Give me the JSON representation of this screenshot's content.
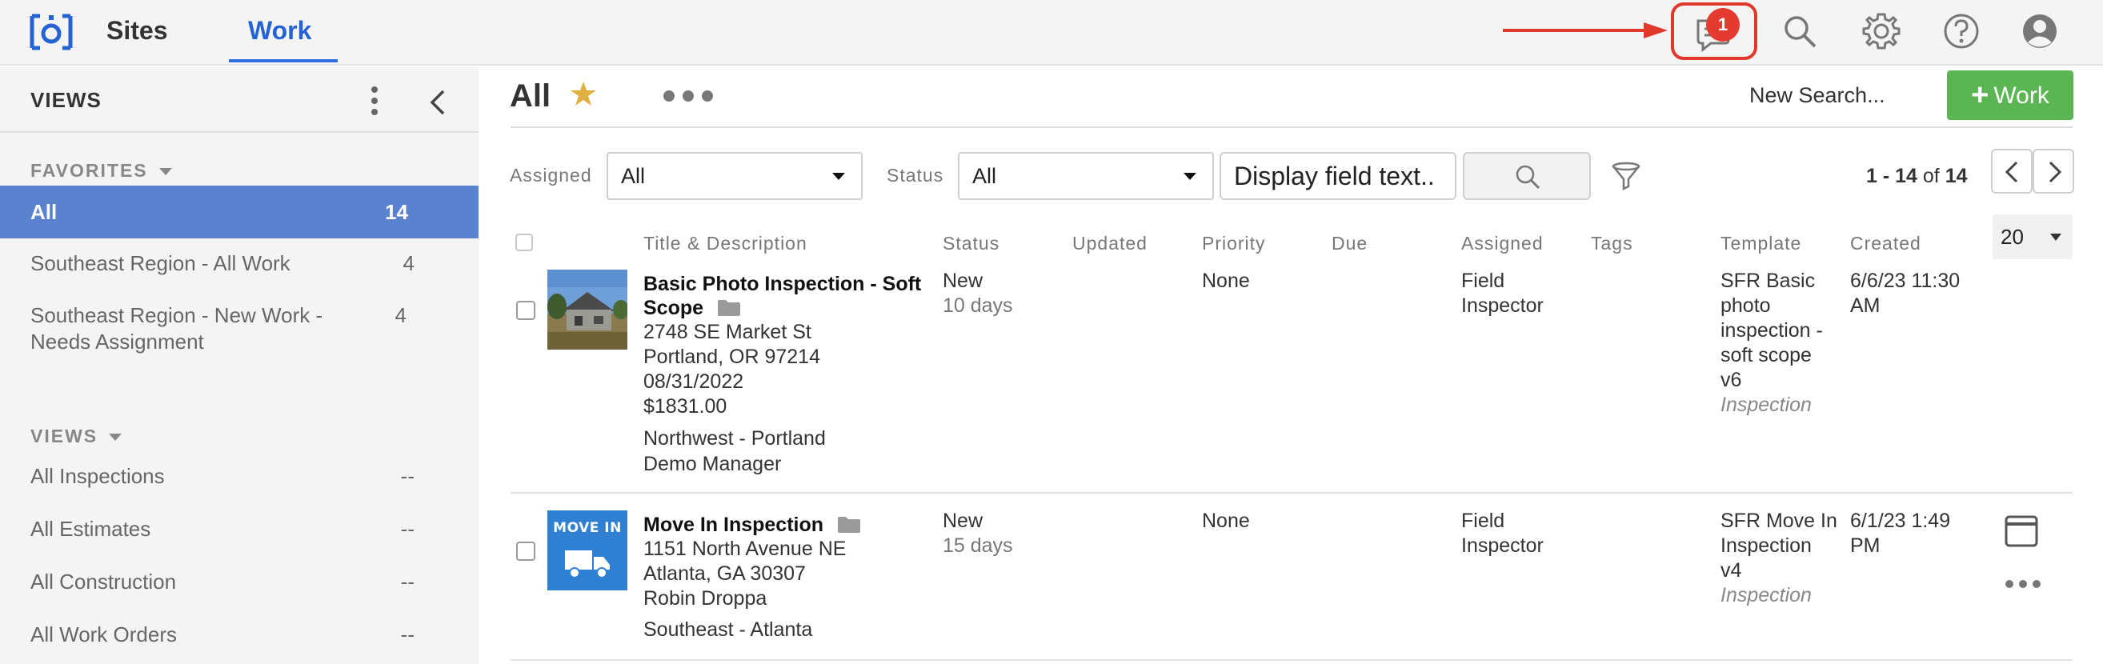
{
  "topbar": {
    "tabs": [
      {
        "label": "Sites"
      },
      {
        "label": "Work",
        "active": true
      }
    ],
    "notification_count": "1",
    "icons": [
      "chat-icon",
      "search-icon",
      "gear-icon",
      "help-icon",
      "user-icon"
    ]
  },
  "sidebar": {
    "title": "VIEWS",
    "favorites_label": "FAVORITES",
    "views_label": "VIEWS",
    "favorites": [
      {
        "label": "All",
        "count": "14"
      },
      {
        "label": "Southeast Region - All Work",
        "count": "4"
      },
      {
        "label": "Southeast Region - New Work -",
        "label2": "Needs Assignment",
        "count": "4"
      }
    ],
    "views": [
      {
        "label": "All Inspections",
        "count": "--"
      },
      {
        "label": "All Estimates",
        "count": "--"
      },
      {
        "label": "All Construction",
        "count": "--"
      },
      {
        "label": "All Work Orders",
        "count": "--"
      }
    ]
  },
  "main": {
    "title": "All",
    "new_search": "New Search...",
    "add_button": "Work",
    "filters": {
      "assigned_label": "Assigned",
      "assigned_value": "All",
      "status_label": "Status",
      "status_value": "All",
      "display_field": "Display field text.."
    },
    "paging": {
      "range": "1 - 14",
      "of": "of",
      "total": "14",
      "per_page": "20"
    },
    "columns": [
      "Title & Description",
      "Status",
      "Updated",
      "Priority",
      "Due",
      "Assigned",
      "Tags",
      "Template",
      "Created"
    ],
    "rows": [
      {
        "title_line1": "Basic Photo Inspection - Soft",
        "title_line2": "Scope",
        "address1": "2748 SE Market St",
        "address2": "Portland, OR 97214",
        "date": "08/31/2022",
        "amount": "$1831.00",
        "region": "Northwest - Portland",
        "manager": "Demo Manager",
        "status": "New",
        "status_age": "10 days",
        "priority": "None",
        "assigned1": "Field",
        "assigned2": "Inspector",
        "template": [
          "SFR Basic",
          "photo",
          "inspection -",
          "soft scope",
          "v6"
        ],
        "template_type": "Inspection",
        "created1": "6/6/23 11:30",
        "created2": "AM"
      },
      {
        "title_line1": "Move In Inspection",
        "thumb_text": "MOVE IN",
        "address1": "1151 North Avenue NE",
        "address2": "Atlanta, GA 30307",
        "contact": "Robin Droppa",
        "region": "Southeast - Atlanta",
        "status": "New",
        "status_age": "15 days",
        "priority": "None",
        "assigned1": "Field",
        "assigned2": "Inspector",
        "template": [
          "SFR Move In",
          "Inspection",
          "v4"
        ],
        "template_type": "Inspection",
        "created1": "6/1/23 1:49",
        "created2": "PM"
      }
    ]
  },
  "colors": {
    "brand_blue": "#2563d4",
    "active_view": "#5b82cf",
    "add_button": "#5ab552",
    "badge": "#e53a2f",
    "star": "#e0b040"
  }
}
